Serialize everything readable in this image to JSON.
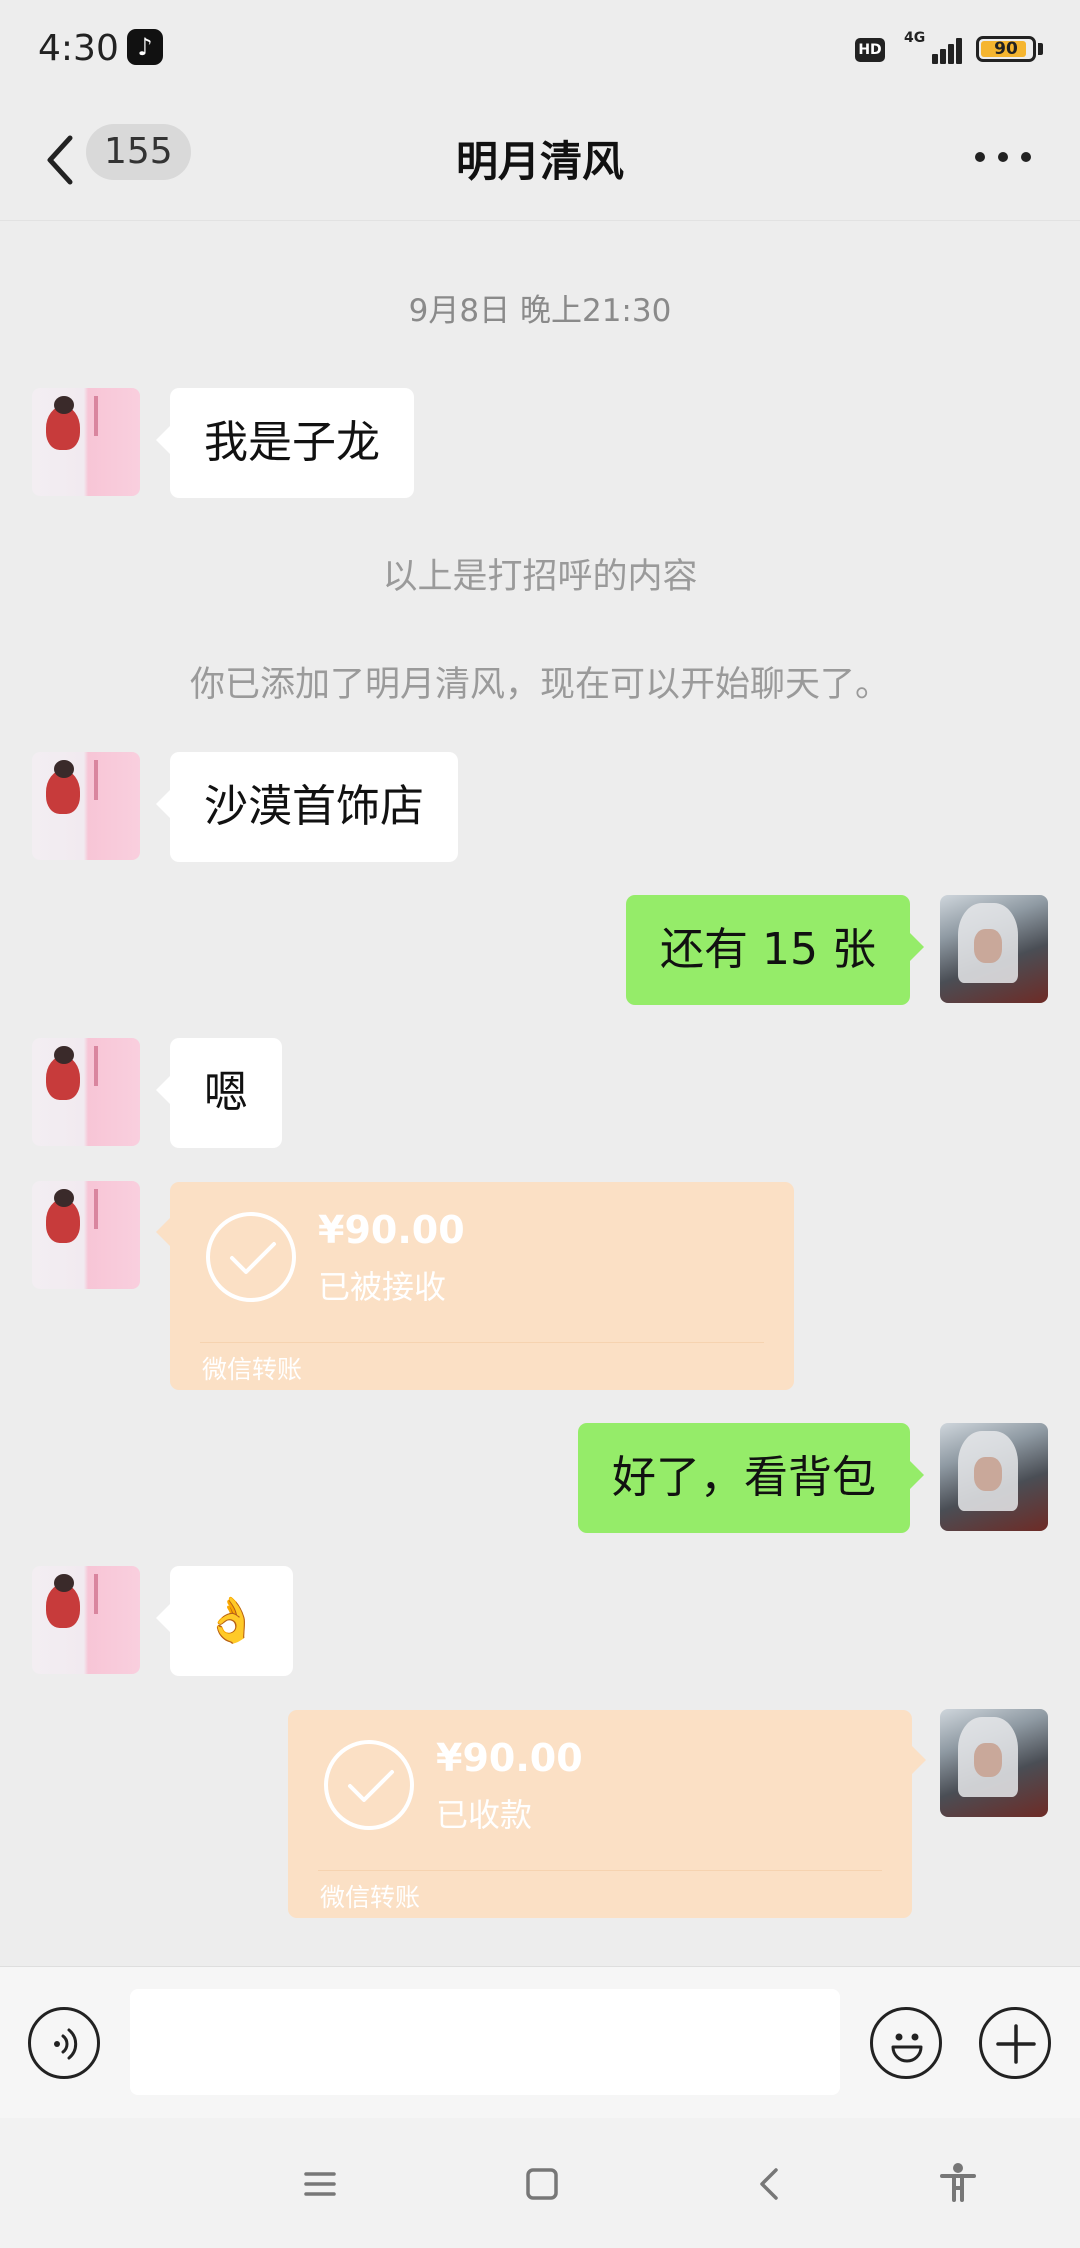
{
  "status_bar": {
    "time": "4:30",
    "app_icon": "tiktok-icon",
    "hd_label": "HD",
    "network": "4G",
    "battery": "90",
    "battery_level": 0.9
  },
  "header": {
    "back_icon": "chevron-left-icon",
    "unread_count": "155",
    "title": "明月清风",
    "more_icon": "more-horizontal-icon"
  },
  "chat": {
    "timestamp": "9月8日 晚上21:30",
    "greeting_notice": "以上是打招呼的内容",
    "added_notice": "你已添加了明月清风，现在可以开始聊天了。",
    "messages": [
      {
        "side": "left",
        "type": "text",
        "text": "我是子龙"
      },
      {
        "side": "left",
        "type": "text",
        "text": "沙漠首饰店"
      },
      {
        "side": "right",
        "type": "text",
        "text": "还有 15 张"
      },
      {
        "side": "left",
        "type": "text",
        "text": "嗯"
      },
      {
        "side": "left",
        "type": "transfer",
        "amount": "¥90.00",
        "status": "已被接收",
        "brand": "微信转账"
      },
      {
        "side": "right",
        "type": "text",
        "text": "好了，看背包"
      },
      {
        "side": "left",
        "type": "text",
        "text": "👌"
      },
      {
        "side": "right",
        "type": "transfer",
        "amount": "¥90.00",
        "status": "已收款",
        "brand": "微信转账"
      }
    ]
  },
  "input_bar": {
    "voice_icon": "voice-icon",
    "input_value": "",
    "emoji_icon": "emoji-icon",
    "plus_icon": "plus-icon"
  },
  "nav_bar": {
    "icons": [
      "menu-icon",
      "home-square-icon",
      "back-icon",
      "accessibility-icon"
    ]
  },
  "colors": {
    "background": "#ededed",
    "bubble_green": "#95ec69",
    "bubble_white": "#ffffff",
    "transfer_card": "#fbe0c5"
  }
}
